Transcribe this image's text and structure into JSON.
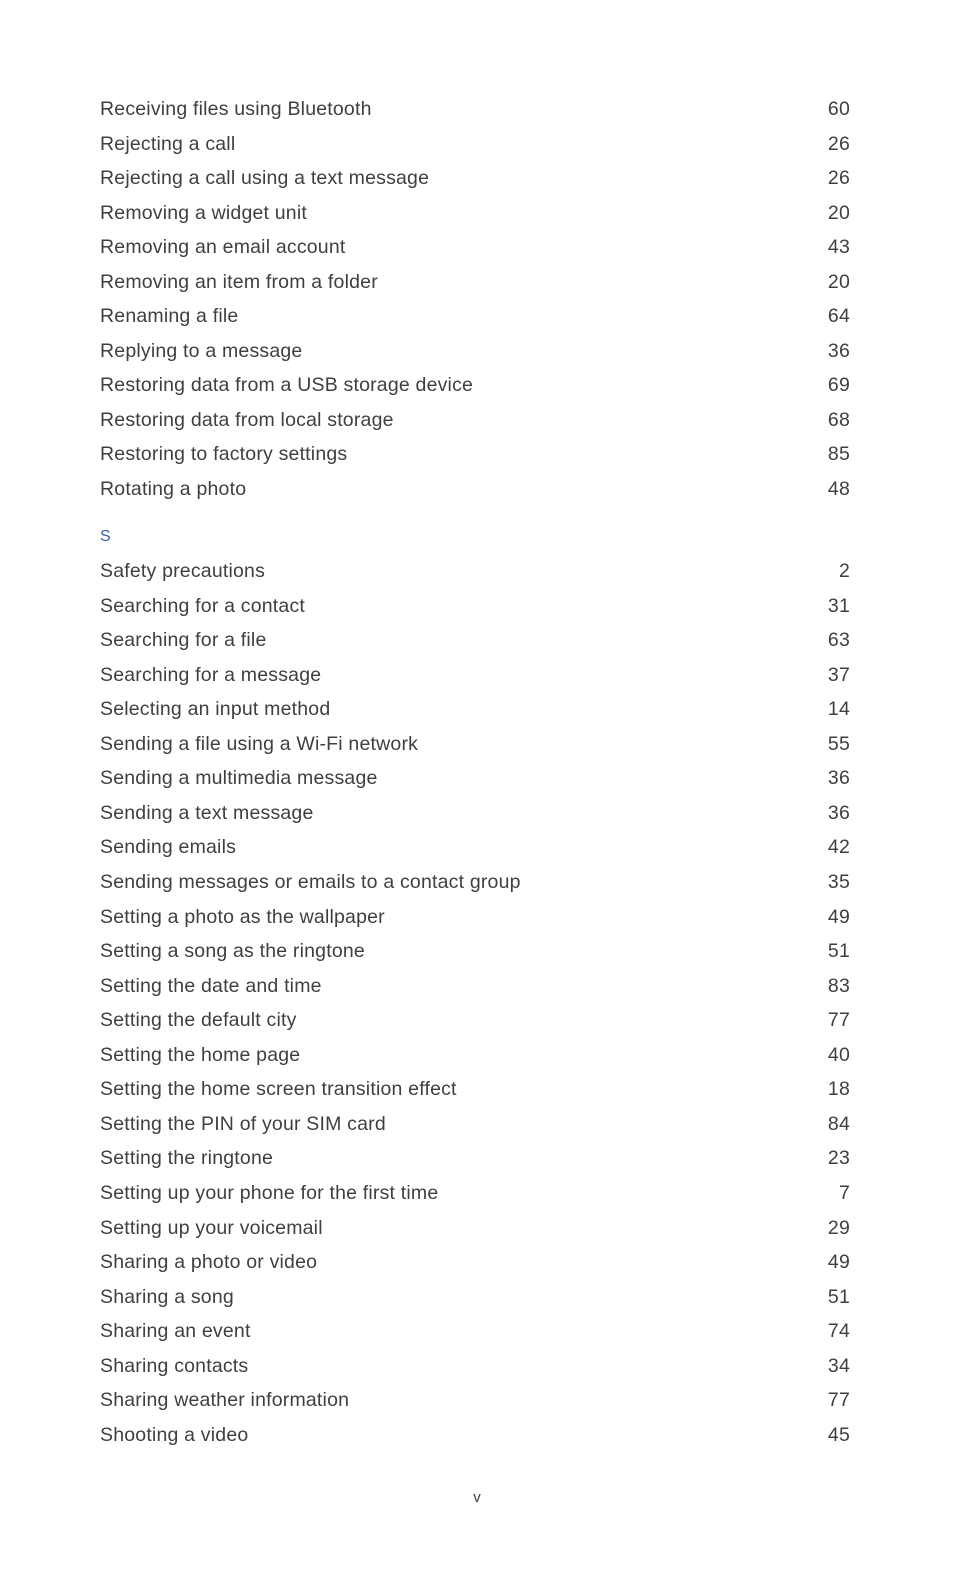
{
  "document": {
    "type": "index",
    "folio": "v",
    "heading_color": "#3d5aa8",
    "text_color": "#3f3f3f"
  },
  "blocks": [
    {
      "letter": null,
      "entries": [
        {
          "title": "Receiving files using Bluetooth",
          "page": "60"
        },
        {
          "title": "Rejecting a call",
          "page": "26"
        },
        {
          "title": "Rejecting a call using a text message",
          "page": "26"
        },
        {
          "title": "Removing a widget unit",
          "page": "20"
        },
        {
          "title": "Removing an email account",
          "page": "43"
        },
        {
          "title": "Removing an item from a folder",
          "page": "20"
        },
        {
          "title": "Renaming a file",
          "page": "64"
        },
        {
          "title": "Replying to a message",
          "page": "36"
        },
        {
          "title": "Restoring data from a USB storage device",
          "page": "69"
        },
        {
          "title": "Restoring data from local storage",
          "page": "68"
        },
        {
          "title": "Restoring to factory settings",
          "page": "85"
        },
        {
          "title": "Rotating a photo",
          "page": "48"
        }
      ]
    },
    {
      "letter": "S",
      "entries": [
        {
          "title": "Safety precautions",
          "page": "2"
        },
        {
          "title": "Searching for a contact",
          "page": "31"
        },
        {
          "title": "Searching for a file",
          "page": "63"
        },
        {
          "title": "Searching for a message",
          "page": "37"
        },
        {
          "title": "Selecting an input method",
          "page": "14"
        },
        {
          "title": "Sending a file using a Wi-Fi network",
          "page": "55"
        },
        {
          "title": "Sending a multimedia message",
          "page": "36"
        },
        {
          "title": "Sending a text message",
          "page": "36"
        },
        {
          "title": "Sending emails",
          "page": "42"
        },
        {
          "title": "Sending messages or emails to a contact group",
          "page": "35"
        },
        {
          "title": "Setting a photo as the wallpaper",
          "page": "49"
        },
        {
          "title": "Setting a song as the ringtone",
          "page": "51"
        },
        {
          "title": "Setting the date and time",
          "page": "83"
        },
        {
          "title": "Setting the default city",
          "page": "77"
        },
        {
          "title": "Setting the home page",
          "page": "40"
        },
        {
          "title": "Setting the home screen transition effect",
          "page": "18"
        },
        {
          "title": "Setting the PIN of your SIM card",
          "page": "84"
        },
        {
          "title": "Setting the ringtone",
          "page": "23"
        },
        {
          "title": "Setting up your phone for the first time",
          "page": "7"
        },
        {
          "title": "Setting up your voicemail",
          "page": "29"
        },
        {
          "title": "Sharing a photo or video",
          "page": "49"
        },
        {
          "title": "Sharing a song",
          "page": "51"
        },
        {
          "title": "Sharing an event",
          "page": "74"
        },
        {
          "title": "Sharing contacts",
          "page": "34"
        },
        {
          "title": "Sharing weather information",
          "page": "77"
        },
        {
          "title": "Shooting a video",
          "page": "45"
        }
      ]
    }
  ]
}
